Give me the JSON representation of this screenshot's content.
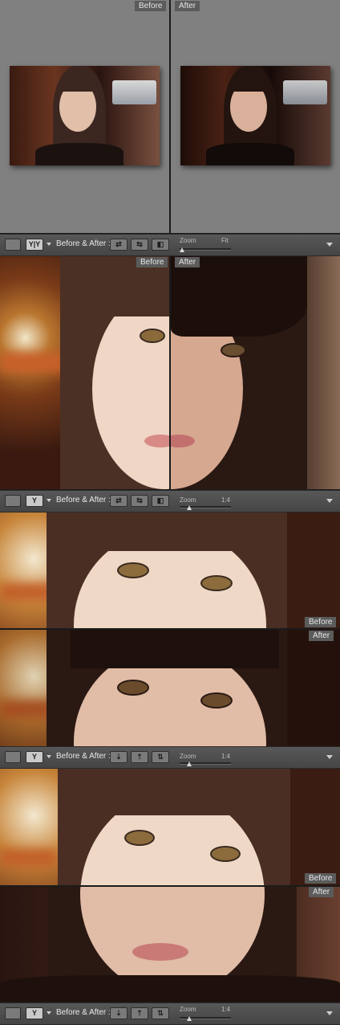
{
  "panels": {
    "p1": {
      "before_label": "Before",
      "after_label": "After"
    },
    "p2": {
      "before_label": "Before",
      "after_label": "After"
    },
    "p3": {
      "before_label": "Before",
      "after_label": "After"
    },
    "p4": {
      "before_label": "Before",
      "after_label": "After"
    }
  },
  "toolbars": [
    {
      "before_after_label": "Before & After :",
      "zoom_label": "Zoom",
      "zoom_value": "Fit",
      "view_mode_glyph": "Y|Y",
      "swap_icons": [
        "⇄",
        "⇆",
        "◧"
      ]
    },
    {
      "before_after_label": "Before & After :",
      "zoom_label": "Zoom",
      "zoom_value": "1:4",
      "view_mode_glyph": "Y",
      "swap_icons": [
        "⇄",
        "⇆",
        "◧"
      ]
    },
    {
      "before_after_label": "Before & After :",
      "zoom_label": "Zoom",
      "zoom_value": "1:4",
      "view_mode_glyph": "Y",
      "swap_icons": [
        "⇣",
        "⇡",
        "⇅"
      ]
    },
    {
      "before_after_label": "Before & After :",
      "zoom_label": "Zoom",
      "zoom_value": "1:4",
      "view_mode_glyph": "Y",
      "swap_icons": [
        "⇣",
        "⇡",
        "⇅"
      ]
    }
  ],
  "icons": {
    "loupe": "loupe-view-icon",
    "before_after": "before-after-view-icon",
    "swap": "swap-settings-icon",
    "copy": "copy-settings-icon",
    "toggle": "toggle-settings-icon",
    "menu": "toolbar-menu-icon"
  },
  "colors": {
    "background": "#1b1b1b",
    "neutral_gray": "#808080",
    "toolbar": "#4e4e4e",
    "label_bg": "#5b5b5b"
  }
}
